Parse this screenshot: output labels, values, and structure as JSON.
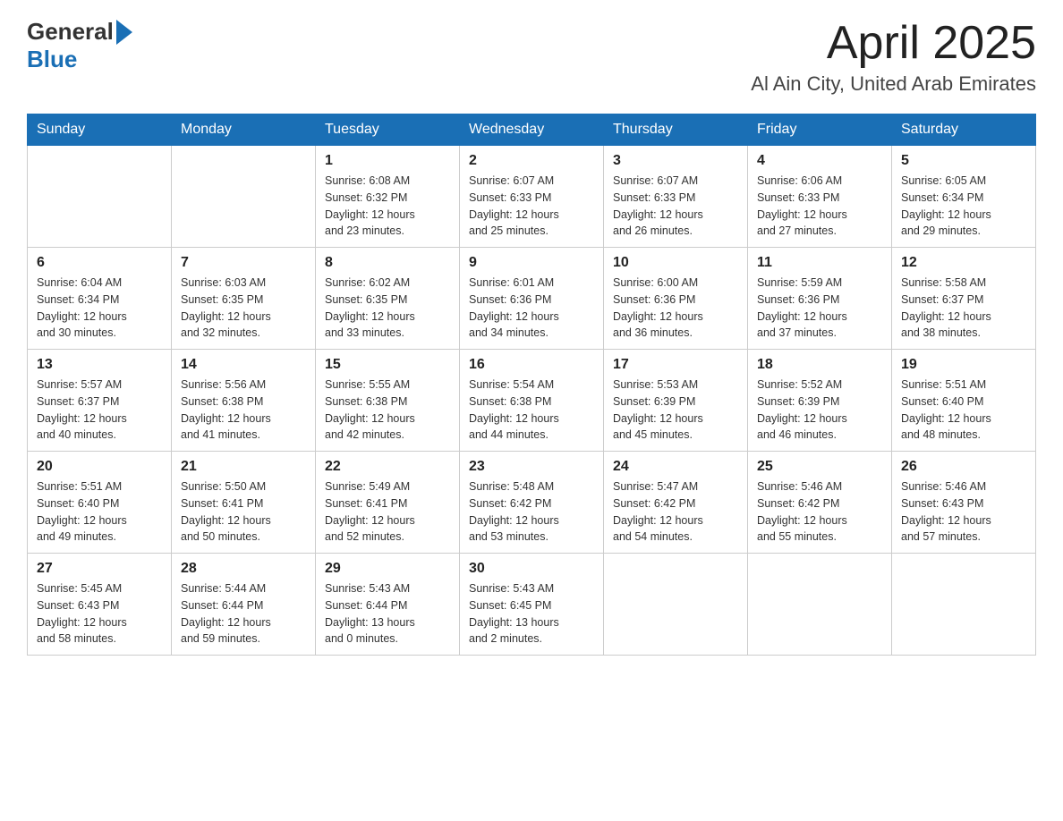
{
  "header": {
    "title": "April 2025",
    "subtitle": "Al Ain City, United Arab Emirates",
    "logo_general": "General",
    "logo_blue": "Blue"
  },
  "days_of_week": [
    "Sunday",
    "Monday",
    "Tuesday",
    "Wednesday",
    "Thursday",
    "Friday",
    "Saturday"
  ],
  "weeks": [
    [
      {
        "day": "",
        "info": ""
      },
      {
        "day": "",
        "info": ""
      },
      {
        "day": "1",
        "sunrise": "6:08 AM",
        "sunset": "6:32 PM",
        "daylight": "12 hours and 23 minutes."
      },
      {
        "day": "2",
        "sunrise": "6:07 AM",
        "sunset": "6:33 PM",
        "daylight": "12 hours and 25 minutes."
      },
      {
        "day": "3",
        "sunrise": "6:07 AM",
        "sunset": "6:33 PM",
        "daylight": "12 hours and 26 minutes."
      },
      {
        "day": "4",
        "sunrise": "6:06 AM",
        "sunset": "6:33 PM",
        "daylight": "12 hours and 27 minutes."
      },
      {
        "day": "5",
        "sunrise": "6:05 AM",
        "sunset": "6:34 PM",
        "daylight": "12 hours and 29 minutes."
      }
    ],
    [
      {
        "day": "6",
        "sunrise": "6:04 AM",
        "sunset": "6:34 PM",
        "daylight": "12 hours and 30 minutes."
      },
      {
        "day": "7",
        "sunrise": "6:03 AM",
        "sunset": "6:35 PM",
        "daylight": "12 hours and 32 minutes."
      },
      {
        "day": "8",
        "sunrise": "6:02 AM",
        "sunset": "6:35 PM",
        "daylight": "12 hours and 33 minutes."
      },
      {
        "day": "9",
        "sunrise": "6:01 AM",
        "sunset": "6:36 PM",
        "daylight": "12 hours and 34 minutes."
      },
      {
        "day": "10",
        "sunrise": "6:00 AM",
        "sunset": "6:36 PM",
        "daylight": "12 hours and 36 minutes."
      },
      {
        "day": "11",
        "sunrise": "5:59 AM",
        "sunset": "6:36 PM",
        "daylight": "12 hours and 37 minutes."
      },
      {
        "day": "12",
        "sunrise": "5:58 AM",
        "sunset": "6:37 PM",
        "daylight": "12 hours and 38 minutes."
      }
    ],
    [
      {
        "day": "13",
        "sunrise": "5:57 AM",
        "sunset": "6:37 PM",
        "daylight": "12 hours and 40 minutes."
      },
      {
        "day": "14",
        "sunrise": "5:56 AM",
        "sunset": "6:38 PM",
        "daylight": "12 hours and 41 minutes."
      },
      {
        "day": "15",
        "sunrise": "5:55 AM",
        "sunset": "6:38 PM",
        "daylight": "12 hours and 42 minutes."
      },
      {
        "day": "16",
        "sunrise": "5:54 AM",
        "sunset": "6:38 PM",
        "daylight": "12 hours and 44 minutes."
      },
      {
        "day": "17",
        "sunrise": "5:53 AM",
        "sunset": "6:39 PM",
        "daylight": "12 hours and 45 minutes."
      },
      {
        "day": "18",
        "sunrise": "5:52 AM",
        "sunset": "6:39 PM",
        "daylight": "12 hours and 46 minutes."
      },
      {
        "day": "19",
        "sunrise": "5:51 AM",
        "sunset": "6:40 PM",
        "daylight": "12 hours and 48 minutes."
      }
    ],
    [
      {
        "day": "20",
        "sunrise": "5:51 AM",
        "sunset": "6:40 PM",
        "daylight": "12 hours and 49 minutes."
      },
      {
        "day": "21",
        "sunrise": "5:50 AM",
        "sunset": "6:41 PM",
        "daylight": "12 hours and 50 minutes."
      },
      {
        "day": "22",
        "sunrise": "5:49 AM",
        "sunset": "6:41 PM",
        "daylight": "12 hours and 52 minutes."
      },
      {
        "day": "23",
        "sunrise": "5:48 AM",
        "sunset": "6:42 PM",
        "daylight": "12 hours and 53 minutes."
      },
      {
        "day": "24",
        "sunrise": "5:47 AM",
        "sunset": "6:42 PM",
        "daylight": "12 hours and 54 minutes."
      },
      {
        "day": "25",
        "sunrise": "5:46 AM",
        "sunset": "6:42 PM",
        "daylight": "12 hours and 55 minutes."
      },
      {
        "day": "26",
        "sunrise": "5:46 AM",
        "sunset": "6:43 PM",
        "daylight": "12 hours and 57 minutes."
      }
    ],
    [
      {
        "day": "27",
        "sunrise": "5:45 AM",
        "sunset": "6:43 PM",
        "daylight": "12 hours and 58 minutes."
      },
      {
        "day": "28",
        "sunrise": "5:44 AM",
        "sunset": "6:44 PM",
        "daylight": "12 hours and 59 minutes."
      },
      {
        "day": "29",
        "sunrise": "5:43 AM",
        "sunset": "6:44 PM",
        "daylight": "13 hours and 0 minutes."
      },
      {
        "day": "30",
        "sunrise": "5:43 AM",
        "sunset": "6:45 PM",
        "daylight": "13 hours and 2 minutes."
      },
      {
        "day": "",
        "info": ""
      },
      {
        "day": "",
        "info": ""
      },
      {
        "day": "",
        "info": ""
      }
    ]
  ],
  "labels": {
    "sunrise": "Sunrise: ",
    "sunset": "Sunset: ",
    "daylight": "Daylight: "
  }
}
